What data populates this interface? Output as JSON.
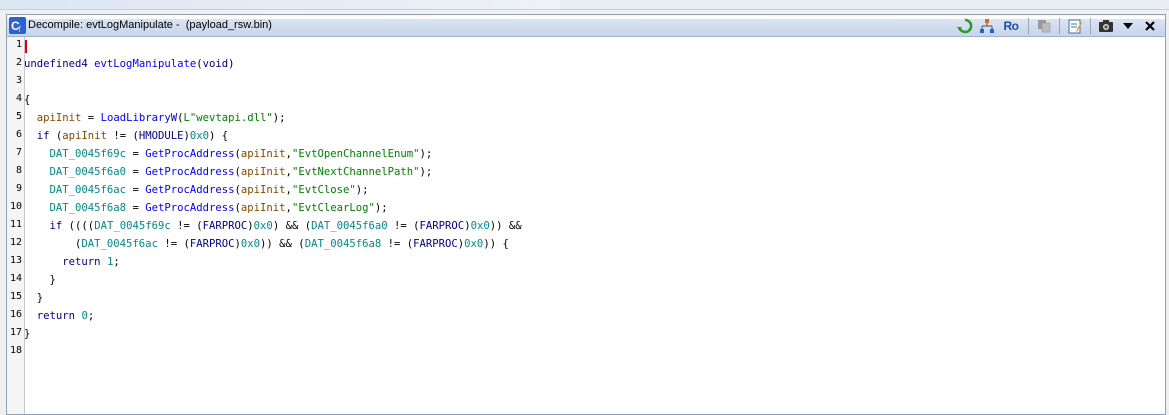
{
  "window": {
    "title": "Decompile: evtLogManipulate -  (payload_rsw.bin)",
    "toolbar": {
      "refresh_icon": "refresh-icon",
      "graph_icon": "function-graph-icon",
      "ro_label": "Ro",
      "copy_icon": "copy-icon",
      "edit_icon": "edit-icon",
      "snapshot_icon": "snapshot-icon",
      "menu_icon": "chevron-down-icon",
      "close_icon": "close-icon"
    }
  },
  "gutter": [
    "1",
    "2",
    "3",
    "4",
    "5",
    "6",
    "7",
    "8",
    "9",
    "10",
    "11",
    "12",
    "13",
    "14",
    "15",
    "16",
    "17",
    "18"
  ],
  "code": {
    "l2": [
      [
        "kw",
        "undefined4"
      ],
      [
        "p",
        " "
      ],
      [
        "fn",
        "evtLogManipulate"
      ],
      [
        "p",
        "("
      ],
      [
        "ty",
        "void"
      ],
      [
        "p",
        ")"
      ]
    ],
    "l4": [
      [
        "p",
        "{"
      ]
    ],
    "l5": [
      [
        "p",
        "  "
      ],
      [
        "var",
        "apiInit"
      ],
      [
        "p",
        " = "
      ],
      [
        "fn",
        "LoadLibraryW"
      ],
      [
        "p",
        "("
      ],
      [
        "str",
        "L\"wevtapi.dll\""
      ],
      [
        "p",
        ");"
      ]
    ],
    "l6": [
      [
        "p",
        "  "
      ],
      [
        "kw",
        "if"
      ],
      [
        "p",
        " ("
      ],
      [
        "var",
        "apiInit"
      ],
      [
        "p",
        " != ("
      ],
      [
        "ty",
        "HMODULE"
      ],
      [
        "p",
        ")"
      ],
      [
        "num",
        "0x0"
      ],
      [
        "p",
        ") {"
      ]
    ],
    "l7": [
      [
        "p",
        "    "
      ],
      [
        "gl",
        "DAT_0045f69c"
      ],
      [
        "p",
        " = "
      ],
      [
        "fn",
        "GetProcAddress"
      ],
      [
        "p",
        "("
      ],
      [
        "var",
        "apiInit"
      ],
      [
        "p",
        ","
      ],
      [
        "str",
        "\"EvtOpenChannelEnum\""
      ],
      [
        "p",
        ");"
      ]
    ],
    "l8": [
      [
        "p",
        "    "
      ],
      [
        "gl",
        "DAT_0045f6a0"
      ],
      [
        "p",
        " = "
      ],
      [
        "fn",
        "GetProcAddress"
      ],
      [
        "p",
        "("
      ],
      [
        "var",
        "apiInit"
      ],
      [
        "p",
        ","
      ],
      [
        "str",
        "\"EvtNextChannelPath\""
      ],
      [
        "p",
        ");"
      ]
    ],
    "l9": [
      [
        "p",
        "    "
      ],
      [
        "gl",
        "DAT_0045f6ac"
      ],
      [
        "p",
        " = "
      ],
      [
        "fn",
        "GetProcAddress"
      ],
      [
        "p",
        "("
      ],
      [
        "var",
        "apiInit"
      ],
      [
        "p",
        ","
      ],
      [
        "str",
        "\"EvtClose\""
      ],
      [
        "p",
        ");"
      ]
    ],
    "l10": [
      [
        "p",
        "    "
      ],
      [
        "gl",
        "DAT_0045f6a8"
      ],
      [
        "p",
        " = "
      ],
      [
        "fn",
        "GetProcAddress"
      ],
      [
        "p",
        "("
      ],
      [
        "var",
        "apiInit"
      ],
      [
        "p",
        ","
      ],
      [
        "str",
        "\"EvtClearLog\""
      ],
      [
        "p",
        ");"
      ]
    ],
    "l11": [
      [
        "p",
        "    "
      ],
      [
        "kw",
        "if"
      ],
      [
        "p",
        " ((("
      ],
      [
        "p",
        "("
      ],
      [
        "gl",
        "DAT_0045f69c"
      ],
      [
        "p",
        " != ("
      ],
      [
        "ty",
        "FARPROC"
      ],
      [
        "p",
        ")"
      ],
      [
        "num",
        "0x0"
      ],
      [
        "p",
        ") && ("
      ],
      [
        "gl",
        "DAT_0045f6a0"
      ],
      [
        "p",
        " != ("
      ],
      [
        "ty",
        "FARPROC"
      ],
      [
        "p",
        ")"
      ],
      [
        "num",
        "0x0"
      ],
      [
        "p",
        ")) &&"
      ]
    ],
    "l12": [
      [
        "p",
        "        ("
      ],
      [
        "gl",
        "DAT_0045f6ac"
      ],
      [
        "p",
        " != ("
      ],
      [
        "ty",
        "FARPROC"
      ],
      [
        "p",
        ")"
      ],
      [
        "num",
        "0x0"
      ],
      [
        "p",
        ")) && ("
      ],
      [
        "gl",
        "DAT_0045f6a8"
      ],
      [
        "p",
        " != ("
      ],
      [
        "ty",
        "FARPROC"
      ],
      [
        "p",
        ")"
      ],
      [
        "num",
        "0x0"
      ],
      [
        "p",
        ")) {"
      ]
    ],
    "l13": [
      [
        "p",
        "      "
      ],
      [
        "kw",
        "return"
      ],
      [
        "p",
        " "
      ],
      [
        "num",
        "1"
      ],
      [
        "p",
        ";"
      ]
    ],
    "l14": [
      [
        "p",
        "    }"
      ]
    ],
    "l15": [
      [
        "p",
        "  }"
      ]
    ],
    "l16": [
      [
        "p",
        "  "
      ],
      [
        "kw",
        "return"
      ],
      [
        "p",
        " "
      ],
      [
        "num",
        "0"
      ],
      [
        "p",
        ";"
      ]
    ],
    "l17": [
      [
        "p",
        "}"
      ]
    ]
  }
}
